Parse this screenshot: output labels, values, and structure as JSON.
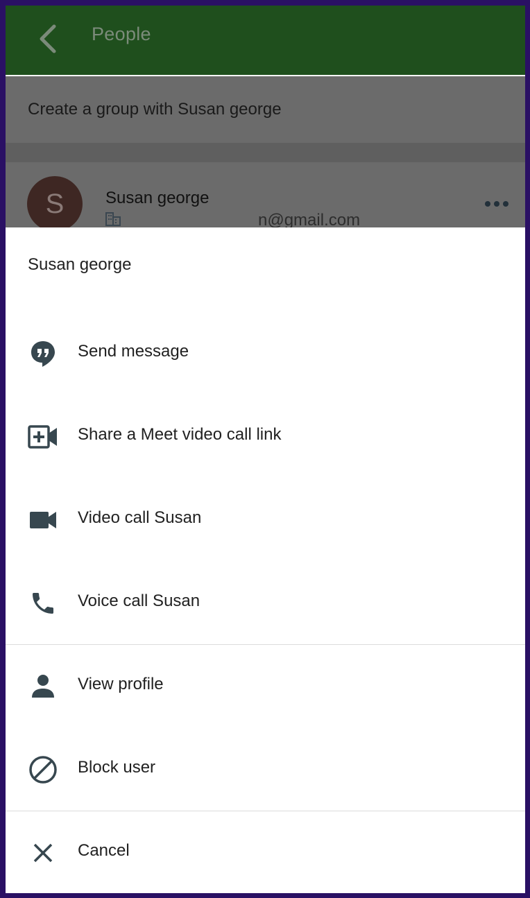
{
  "appbar": {
    "title": "People"
  },
  "group_row": {
    "label": "Create a group with Susan george"
  },
  "contact": {
    "avatar_letter": "S",
    "name": "Susan george",
    "email": "n@gmail.com"
  },
  "sheet": {
    "title": "Susan george",
    "items": [
      {
        "label": "Send message",
        "icon": "chat-bubble-icon"
      },
      {
        "label": "Share a Meet video call link",
        "icon": "add-video-call-icon"
      },
      {
        "label": "Video call Susan",
        "icon": "video-camera-icon"
      },
      {
        "label": "Voice call Susan",
        "icon": "phone-icon"
      },
      {
        "label": "View profile",
        "icon": "person-icon"
      },
      {
        "label": "Block user",
        "icon": "block-icon"
      },
      {
        "label": "Cancel",
        "icon": "close-icon"
      }
    ]
  },
  "colors": {
    "appbar": "#1f4f1d",
    "icon": "#37474f",
    "text": "#212121",
    "avatar": "#3e2723"
  }
}
